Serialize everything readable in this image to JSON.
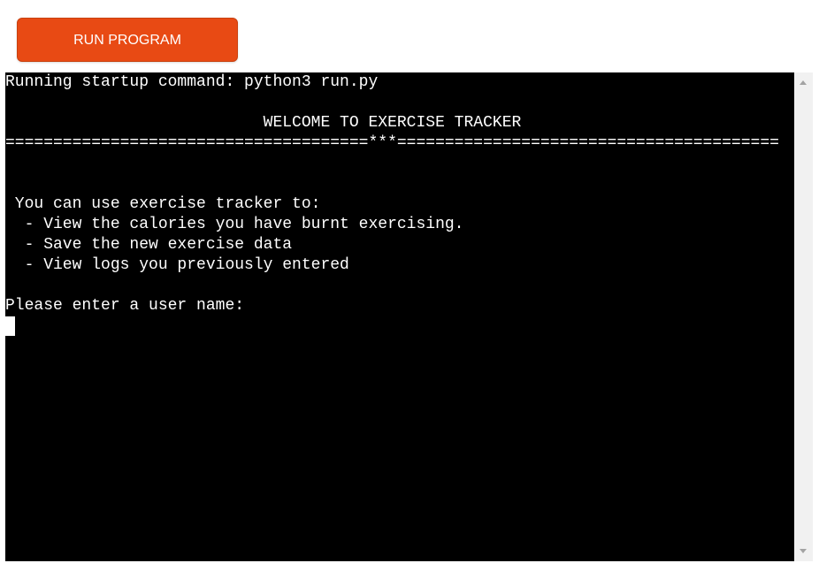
{
  "toolbar": {
    "run_label": "RUN PROGRAM",
    "run_color": "#e84a14"
  },
  "terminal": {
    "lines": [
      "Running startup command: python3 run.py",
      "",
      "                           WELCOME TO EXERCISE TRACKER",
      "======================================***========================================",
      "",
      "",
      " You can use exercise tracker to:",
      "  - View the calories you have burnt exercising.",
      "  - Save the new exercise data",
      "  - View logs you previously entered",
      "",
      "Please enter a user name:"
    ],
    "background": "#000000",
    "text_color": "#ffffff"
  },
  "scrollbar": {
    "up_icon": "chevron-up-icon",
    "down_icon": "chevron-down-icon"
  }
}
